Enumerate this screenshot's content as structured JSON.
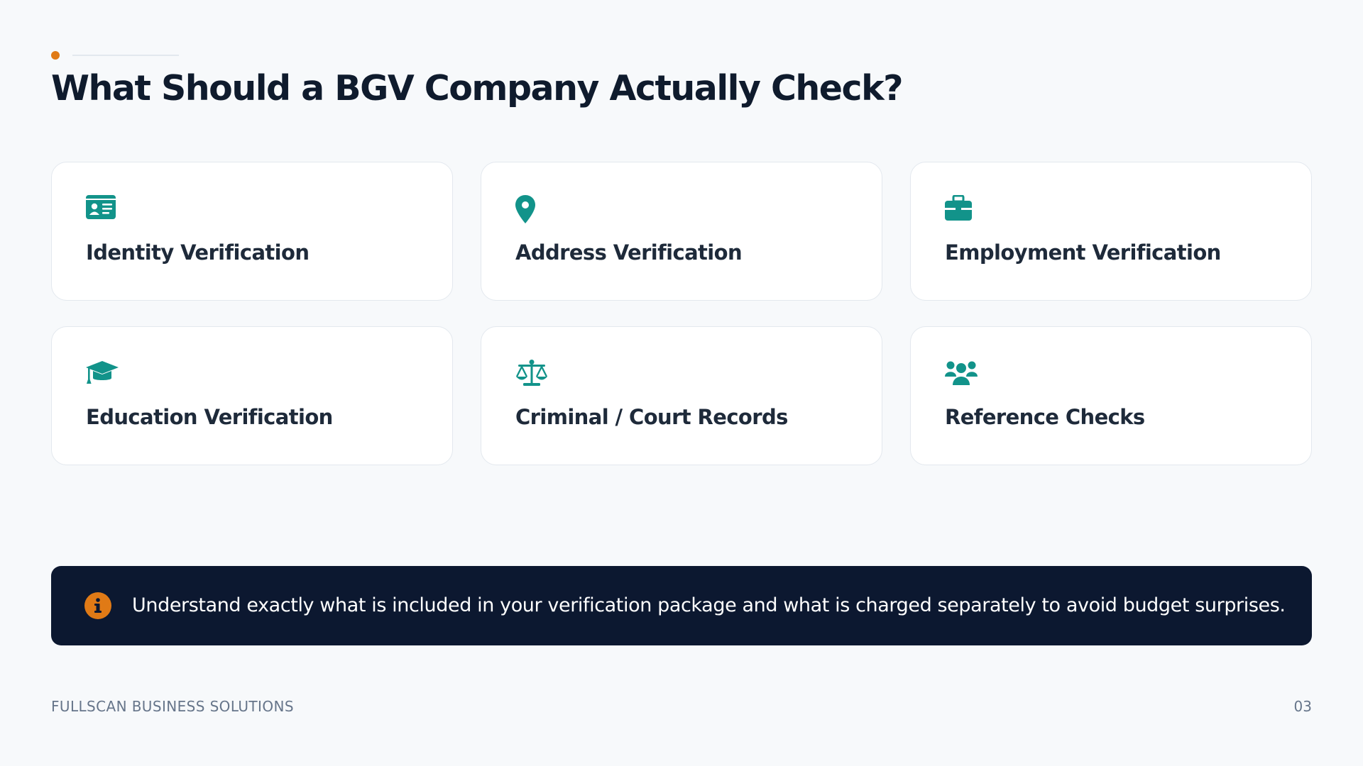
{
  "header": {
    "title": "What Should a BGV Company Actually Check?"
  },
  "cards": [
    {
      "label": "Identity Verification",
      "icon": "id-card-icon"
    },
    {
      "label": "Address Verification",
      "icon": "map-pin-icon"
    },
    {
      "label": "Employment Verification",
      "icon": "briefcase-icon"
    },
    {
      "label": "Education Verification",
      "icon": "graduation-cap-icon"
    },
    {
      "label": "Criminal / Court Records",
      "icon": "scales-icon"
    },
    {
      "label": "Reference Checks",
      "icon": "users-icon"
    }
  ],
  "note": {
    "icon": "info-icon",
    "text": "Understand exactly what is included in your verification package and what is charged separately to avoid budget surprises."
  },
  "footer": {
    "company": "FULLSCAN BUSINESS SOLUTIONS",
    "page_number": "03"
  },
  "colors": {
    "background": "#f7f9fb",
    "accent_orange": "#e07a16",
    "icon_teal": "#12938a",
    "note_background": "#0c1830",
    "title_text": "#0f1b2d",
    "footer_text": "#66758a"
  }
}
